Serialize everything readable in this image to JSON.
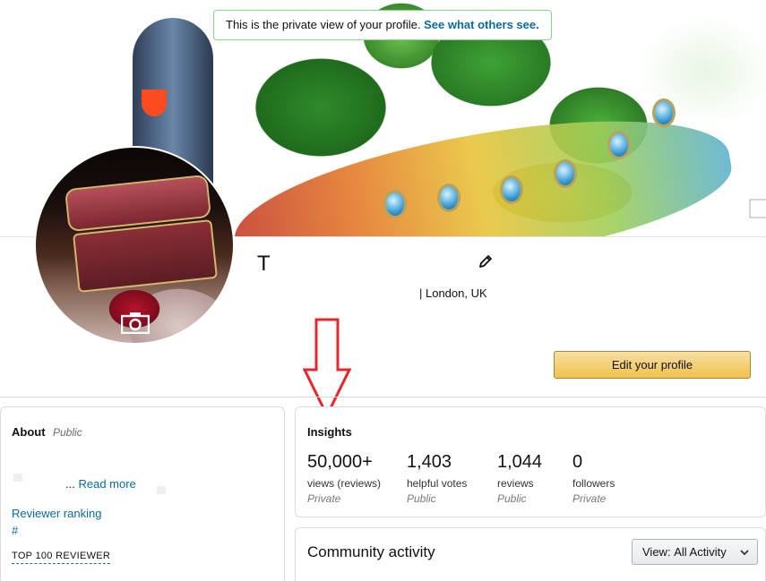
{
  "notice": {
    "text": "This is the private view of your profile.",
    "link": "See what others see."
  },
  "profile": {
    "name": "T",
    "location": "| London, UK",
    "edit_button": "Edit your profile"
  },
  "about": {
    "title": "About",
    "visibility": "Public",
    "ellipsis": "...",
    "read_more": "Read more",
    "ranking_label": "Reviewer ranking",
    "ranking_value": "#",
    "badge": "TOP 100 REVIEWER"
  },
  "insights": {
    "title": "Insights",
    "stats": [
      {
        "value": "50,000+",
        "label": "views (reviews)",
        "visibility": "Private"
      },
      {
        "value": "1,403",
        "label": "helpful votes",
        "visibility": "Public"
      },
      {
        "value": "1,044",
        "label": "reviews",
        "visibility": "Public"
      },
      {
        "value": "0",
        "label": "followers",
        "visibility": "Private"
      }
    ]
  },
  "community": {
    "title": "Community activity",
    "view_prefix": "View:",
    "view_value": "All Activity"
  },
  "icons": {
    "cover_camera": "camera-icon",
    "avatar_camera": "camera-icon",
    "edit_name": "pencil-icon",
    "annotation": "red-down-arrow",
    "dropdown": "chevron-down-icon"
  },
  "colors": {
    "link": "#0a6aa0",
    "notice_border": "#8fd08f",
    "button": "#f0c14b",
    "arrow": "#e8262a"
  }
}
